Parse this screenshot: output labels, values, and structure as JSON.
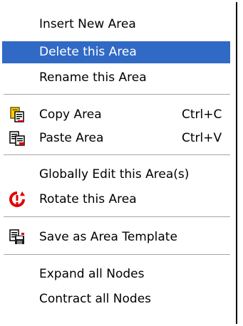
{
  "menu": {
    "items": [
      {
        "label": "Insert New Area"
      },
      {
        "label": "Delete this Area"
      },
      {
        "label": "Rename this Area"
      },
      {
        "label": "Copy Area",
        "shortcut": "Ctrl+C",
        "icon": "copy-icon"
      },
      {
        "label": "Paste Area",
        "shortcut": "Ctrl+V",
        "icon": "paste-icon"
      },
      {
        "label": "Globally Edit this Area(s)"
      },
      {
        "label": "Rotate this Area",
        "icon": "rotate-icon"
      },
      {
        "label": "Save as Area Template",
        "icon": "save-template-icon"
      },
      {
        "label": "Expand all Nodes"
      },
      {
        "label": "Contract all Nodes"
      }
    ],
    "selected_index": 1,
    "colors": {
      "highlight": "#316ac5",
      "highlight_text": "#ffffff",
      "separator": "#a6a6a6"
    }
  }
}
